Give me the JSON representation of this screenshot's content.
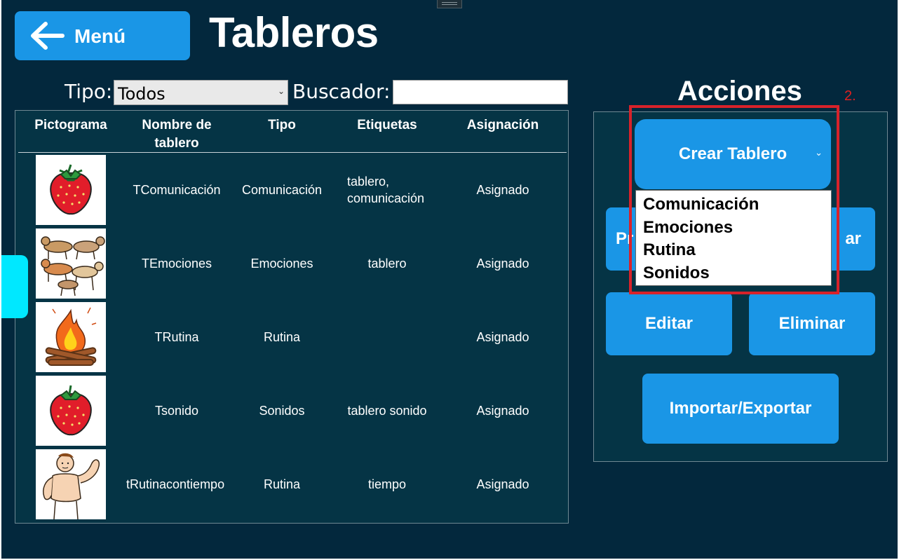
{
  "header": {
    "menu_label": "Menú",
    "title": "Tableros"
  },
  "filters": {
    "tipo_label": "Tipo:",
    "tipo_selected": "Todos",
    "buscador_label": "Buscador:",
    "buscador_value": ""
  },
  "table": {
    "columns": [
      "Pictograma",
      "Nombre de tablero",
      "Tipo",
      "Etiquetas",
      "Asignación"
    ],
    "rows": [
      {
        "picto": "strawberry-icon",
        "nombre": "TComunicación",
        "tipo": "Comunicación",
        "etiquetas": "tablero, comunicación",
        "asignacion": "Asignado"
      },
      {
        "picto": "dogs-icon",
        "nombre": "TEmociones",
        "tipo": "Emociones",
        "etiquetas": "tablero",
        "asignacion": "Asignado"
      },
      {
        "picto": "campfire-icon",
        "nombre": "TRutina",
        "tipo": "Rutina",
        "etiquetas": "",
        "asignacion": "Asignado"
      },
      {
        "picto": "strawberry-icon",
        "nombre": "Tsonido",
        "tipo": "Sonidos",
        "etiquetas": "tablero sonido",
        "asignacion": "Asignado"
      },
      {
        "picto": "strong-man-icon",
        "nombre": "tRutinacontiempo",
        "tipo": "Rutina",
        "etiquetas": "tiempo",
        "asignacion": "Asignado"
      }
    ]
  },
  "actions": {
    "title": "Acciones",
    "step_marker": "2.",
    "crear_label": "Crear Tablero",
    "probar_label": "Pr",
    "copiar_label": "ar",
    "editar_label": "Editar",
    "eliminar_label": "Eliminar",
    "import_label": "Importar/Exportar",
    "dropdown_options": [
      "Comunicación",
      "Emociones",
      "Rutina",
      "Sonidos"
    ]
  },
  "colors": {
    "background": "#03283d",
    "panel": "#053445",
    "button": "#1a96e6",
    "accent_tab": "#00e8ff",
    "highlight": "#d8222a"
  }
}
